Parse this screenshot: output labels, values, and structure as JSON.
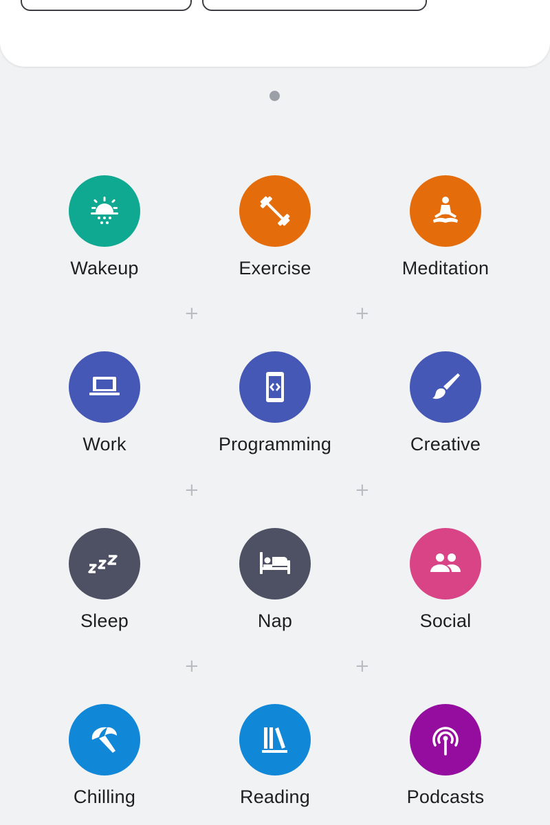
{
  "colors": {
    "teal": "#0fa890",
    "orange": "#e46c0a",
    "indigo": "#4658b5",
    "slate": "#4e5163",
    "pink": "#d84485",
    "blue": "#1187d8",
    "purple": "#950d9e"
  },
  "routines": [
    {
      "label": "Wakeup",
      "icon": "sunrise-icon",
      "color": "#0fa890"
    },
    {
      "label": "Exercise",
      "icon": "dumbbell-icon",
      "color": "#e46c0a"
    },
    {
      "label": "Meditation",
      "icon": "meditation-icon",
      "color": "#e46c0a"
    },
    {
      "label": "Work",
      "icon": "laptop-icon",
      "color": "#4658b5"
    },
    {
      "label": "Programming",
      "icon": "code-phone-icon",
      "color": "#4658b5"
    },
    {
      "label": "Creative",
      "icon": "brush-icon",
      "color": "#4658b5"
    },
    {
      "label": "Sleep",
      "icon": "zzz-icon",
      "color": "#4e5163"
    },
    {
      "label": "Nap",
      "icon": "bed-icon",
      "color": "#4e5163"
    },
    {
      "label": "Social",
      "icon": "people-icon",
      "color": "#d84485"
    },
    {
      "label": "Chilling",
      "icon": "beach-umbrella-icon",
      "color": "#1187d8"
    },
    {
      "label": "Reading",
      "icon": "books-icon",
      "color": "#1187d8"
    },
    {
      "label": "Podcasts",
      "icon": "podcast-icon",
      "color": "#950d9e"
    }
  ],
  "add_marker_glyph": "+"
}
